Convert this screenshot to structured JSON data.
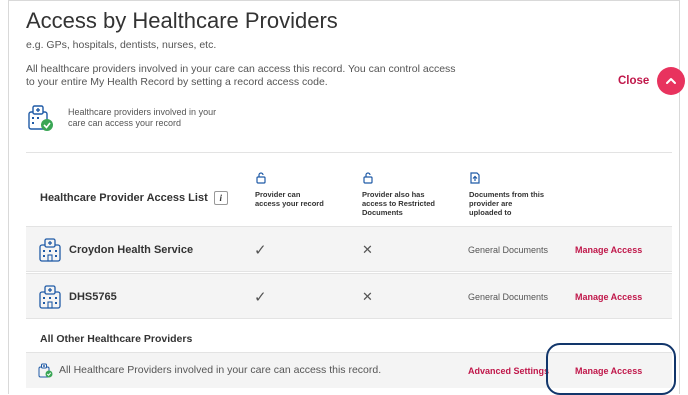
{
  "header": {
    "title": "Access by Healthcare Providers",
    "subtitle": "e.g. GPs, hospitals, dentists, nurses, etc.",
    "description": "All healthcare providers involved in your care can access this record. You can control access to your entire My Health Record by setting a record access code.",
    "close_label": "Close"
  },
  "summary": {
    "text": "Healthcare providers involved in your care can access your record",
    "icon": "hospital-check-icon"
  },
  "access_list": {
    "title": "Healthcare Provider Access List",
    "info_icon": "i",
    "columns": [
      {
        "label": "Provider can access your record",
        "icon": "unlock-icon"
      },
      {
        "label": "Provider also has access to Restricted Documents",
        "icon": "unlock-icon"
      },
      {
        "label": "Documents from this provider are uploaded to",
        "icon": "document-upload-icon"
      }
    ],
    "rows": [
      {
        "name": "Croydon Health Service",
        "can_access": "✓",
        "restricted": "✕",
        "docs": "General Documents",
        "action": "Manage Access"
      },
      {
        "name": "DHS5765",
        "can_access": "✓",
        "restricted": "✕",
        "docs": "General Documents",
        "action": "Manage Access"
      }
    ]
  },
  "other": {
    "title": "All Other Healthcare Providers",
    "text": "All Healthcare Providers involved in your care can access this record.",
    "advanced_label": "Advanced Settings",
    "manage_label": "Manage Access"
  },
  "colors": {
    "accent": "#e8335e",
    "link": "#c0174a",
    "highlight": "#12366b",
    "icon_blue": "#1f5aa6",
    "check_green": "#3aa655"
  }
}
